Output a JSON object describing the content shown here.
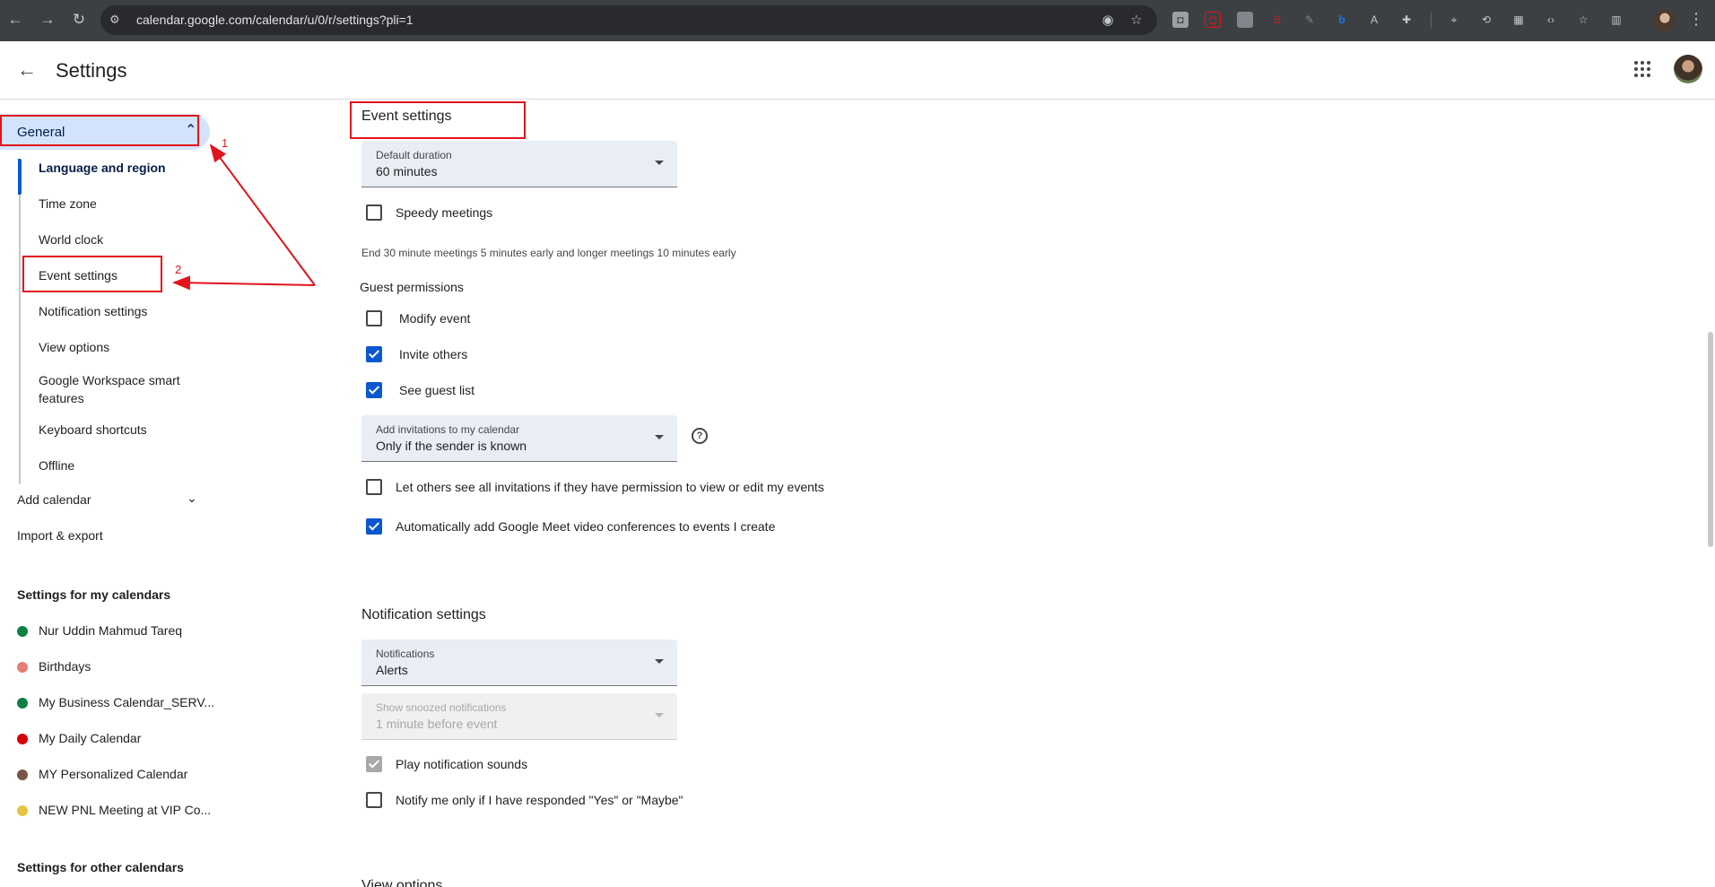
{
  "browser": {
    "url": "calendar.google.com/calendar/u/0/r/settings?pli=1",
    "icons": [
      "back-icon",
      "forward-icon",
      "reload-icon",
      "site-info-icon",
      "eye-icon",
      "star-icon",
      "extensions-icon",
      "profile-icon",
      "menu-icon"
    ]
  },
  "header": {
    "title": "Settings"
  },
  "sidebar": {
    "general_label": "General",
    "sub_items": [
      "Language and region",
      "Time zone",
      "World clock",
      "Event settings",
      "Notification settings",
      "View options",
      "Google Workspace smart features",
      "Keyboard shortcuts",
      "Offline"
    ],
    "add_calendar": "Add calendar",
    "import_export": "Import & export",
    "my_calendars_heading": "Settings for my calendars",
    "calendars": [
      {
        "name": "Nur Uddin Mahmud Tareq",
        "color": "#0b8043"
      },
      {
        "name": "Birthdays",
        "color": "#e67c73"
      },
      {
        "name": "My Business Calendar_SERV...",
        "color": "#0b8043"
      },
      {
        "name": "My Daily Calendar",
        "color": "#d50000"
      },
      {
        "name": "MY Personalized Calendar",
        "color": "#795548"
      },
      {
        "name": "NEW PNL Meeting at VIP Co...",
        "color": "#e4c441"
      }
    ],
    "other_calendars_heading": "Settings for other calendars"
  },
  "annotations": {
    "num1": "1",
    "num2": "2",
    "color": "#e2141c"
  },
  "event_settings": {
    "heading": "Event settings",
    "default_duration": {
      "label": "Default duration",
      "value": "60 minutes"
    },
    "speedy_meetings": {
      "label": "Speedy meetings",
      "checked": false
    },
    "speedy_helper": "End 30 minute meetings 5 minutes early and longer meetings 10 minutes early",
    "guest_permissions_heading": "Guest permissions",
    "modify_event": {
      "label": "Modify event",
      "checked": false
    },
    "invite_others": {
      "label": "Invite others",
      "checked": true
    },
    "see_guest_list": {
      "label": "See guest list",
      "checked": true
    },
    "add_invitations": {
      "label": "Add invitations to my calendar",
      "value": "Only if the sender is known"
    },
    "let_others_see": {
      "label": "Let others see all invitations if they have permission to view or edit my events",
      "checked": false
    },
    "auto_meet": {
      "label": "Automatically add Google Meet video conferences to events I create",
      "checked": true
    }
  },
  "notification_settings": {
    "heading": "Notification settings",
    "notifications": {
      "label": "Notifications",
      "value": "Alerts"
    },
    "snoozed": {
      "label": "Show snoozed notifications",
      "value": "1 minute before event"
    },
    "play_sounds": {
      "label": "Play notification sounds",
      "checked": true
    },
    "notify_only": {
      "label": "Notify me only if I have responded \"Yes\" or \"Maybe\"",
      "checked": false
    }
  },
  "view_options_partial": "View options"
}
